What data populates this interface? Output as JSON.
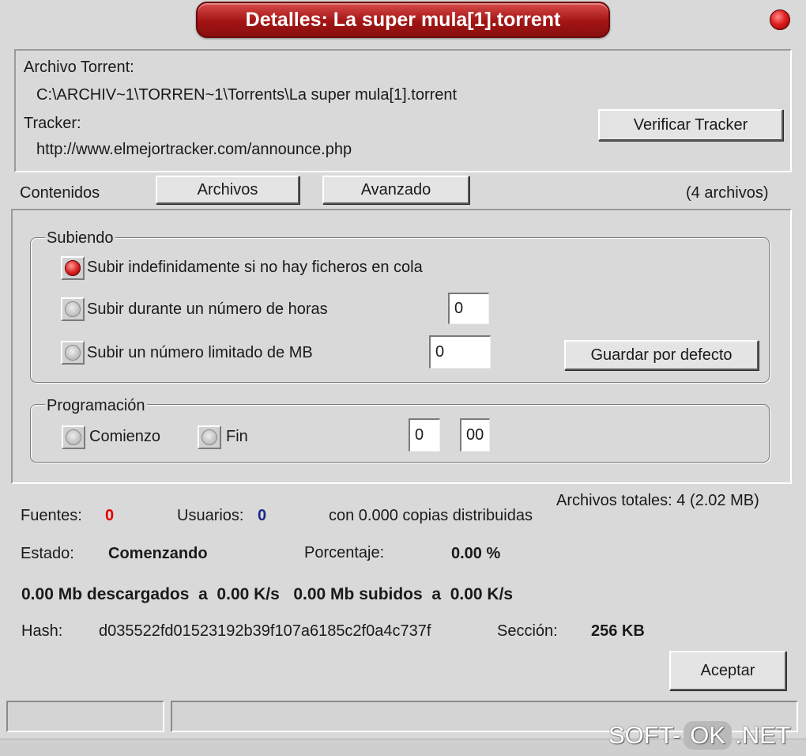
{
  "window": {
    "title": "Detalles: La super mula[1].torrent"
  },
  "info": {
    "torrent_label": "Archivo Torrent:",
    "torrent_path": "C:\\ARCHIV~1\\TORREN~1\\Torrents\\La super mula[1].torrent",
    "tracker_label": "Tracker:",
    "tracker_url": "http://www.elmejortracker.com/announce.php",
    "verify_button": "Verificar Tracker"
  },
  "tabs": {
    "contents_label": "Contenidos",
    "files_button": "Archivos",
    "advanced_button": "Avanzado",
    "file_count": "(4 archivos)"
  },
  "upload": {
    "legend": "Subiendo",
    "option_indefinite": "Subir indefinidamente si no hay ficheros en cola",
    "option_hours": "Subir durante un número de horas",
    "option_mb": "Subir un número limitado de MB",
    "hours_value": "0",
    "mb_value": "0",
    "selected": "indefinite",
    "save_default_button": "Guardar por defecto"
  },
  "schedule": {
    "legend": "Programación",
    "start_label": "Comienzo",
    "end_label": "Fin",
    "hour_value": "0",
    "minute_value": "00"
  },
  "stats": {
    "total_files": "Archivos totales: 4 (2.02 MB)",
    "sources_label": "Fuentes:",
    "sources_value": "0",
    "users_label": "Usuarios:",
    "users_value": "0",
    "copies_text": "con 0.000 copias distribuidas",
    "state_label": "Estado:",
    "state_value": "Comenzando",
    "percent_label": "Porcentaje:",
    "percent_value": "0.00 %",
    "transfer_line": "0.00 Mb descargados  a  0.00 K/s   0.00 Mb subidos  a  0.00 K/s",
    "hash_label": "Hash:",
    "hash_value": "d035522fd01523192b39f107a6185c2f0a4c737f",
    "section_label": "Sección:",
    "section_value": "256 KB"
  },
  "accept_button": "Aceptar",
  "watermark": {
    "left": "SOFT-",
    "middle": "OK",
    "right": ".NET"
  },
  "colors": {
    "title_red": "#a31414",
    "sources_red": "#e00000",
    "users_blue": "#1a2a8a"
  }
}
